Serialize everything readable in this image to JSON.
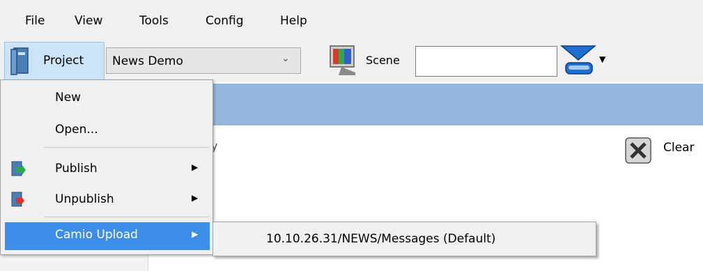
{
  "menubar": {
    "items": [
      "File",
      "View",
      "Tools",
      "Config",
      "Help"
    ]
  },
  "toolbar": {
    "project_label": "Project",
    "project_select": "News Demo",
    "scene_label": "Scene",
    "scene_value": ""
  },
  "content": {
    "clear_label": "Clear",
    "partial_text": "y"
  },
  "project_menu": {
    "items": [
      {
        "label": "New",
        "submenu": false
      },
      {
        "label": "Open...",
        "submenu": false
      },
      {
        "label": "Publish",
        "submenu": true,
        "icon": "publish-icon"
      },
      {
        "label": "Unpublish",
        "submenu": true,
        "icon": "unpublish-icon"
      },
      {
        "label": "Camio Upload",
        "submenu": true,
        "selected": true
      }
    ]
  },
  "camio_submenu": {
    "items": [
      "10.10.26.31/NEWS/Messages (Default)"
    ]
  },
  "colors": {
    "highlight": "#3d8ee8",
    "header_band": "#94b6dc",
    "project_button_bg": "#cce4f7"
  }
}
